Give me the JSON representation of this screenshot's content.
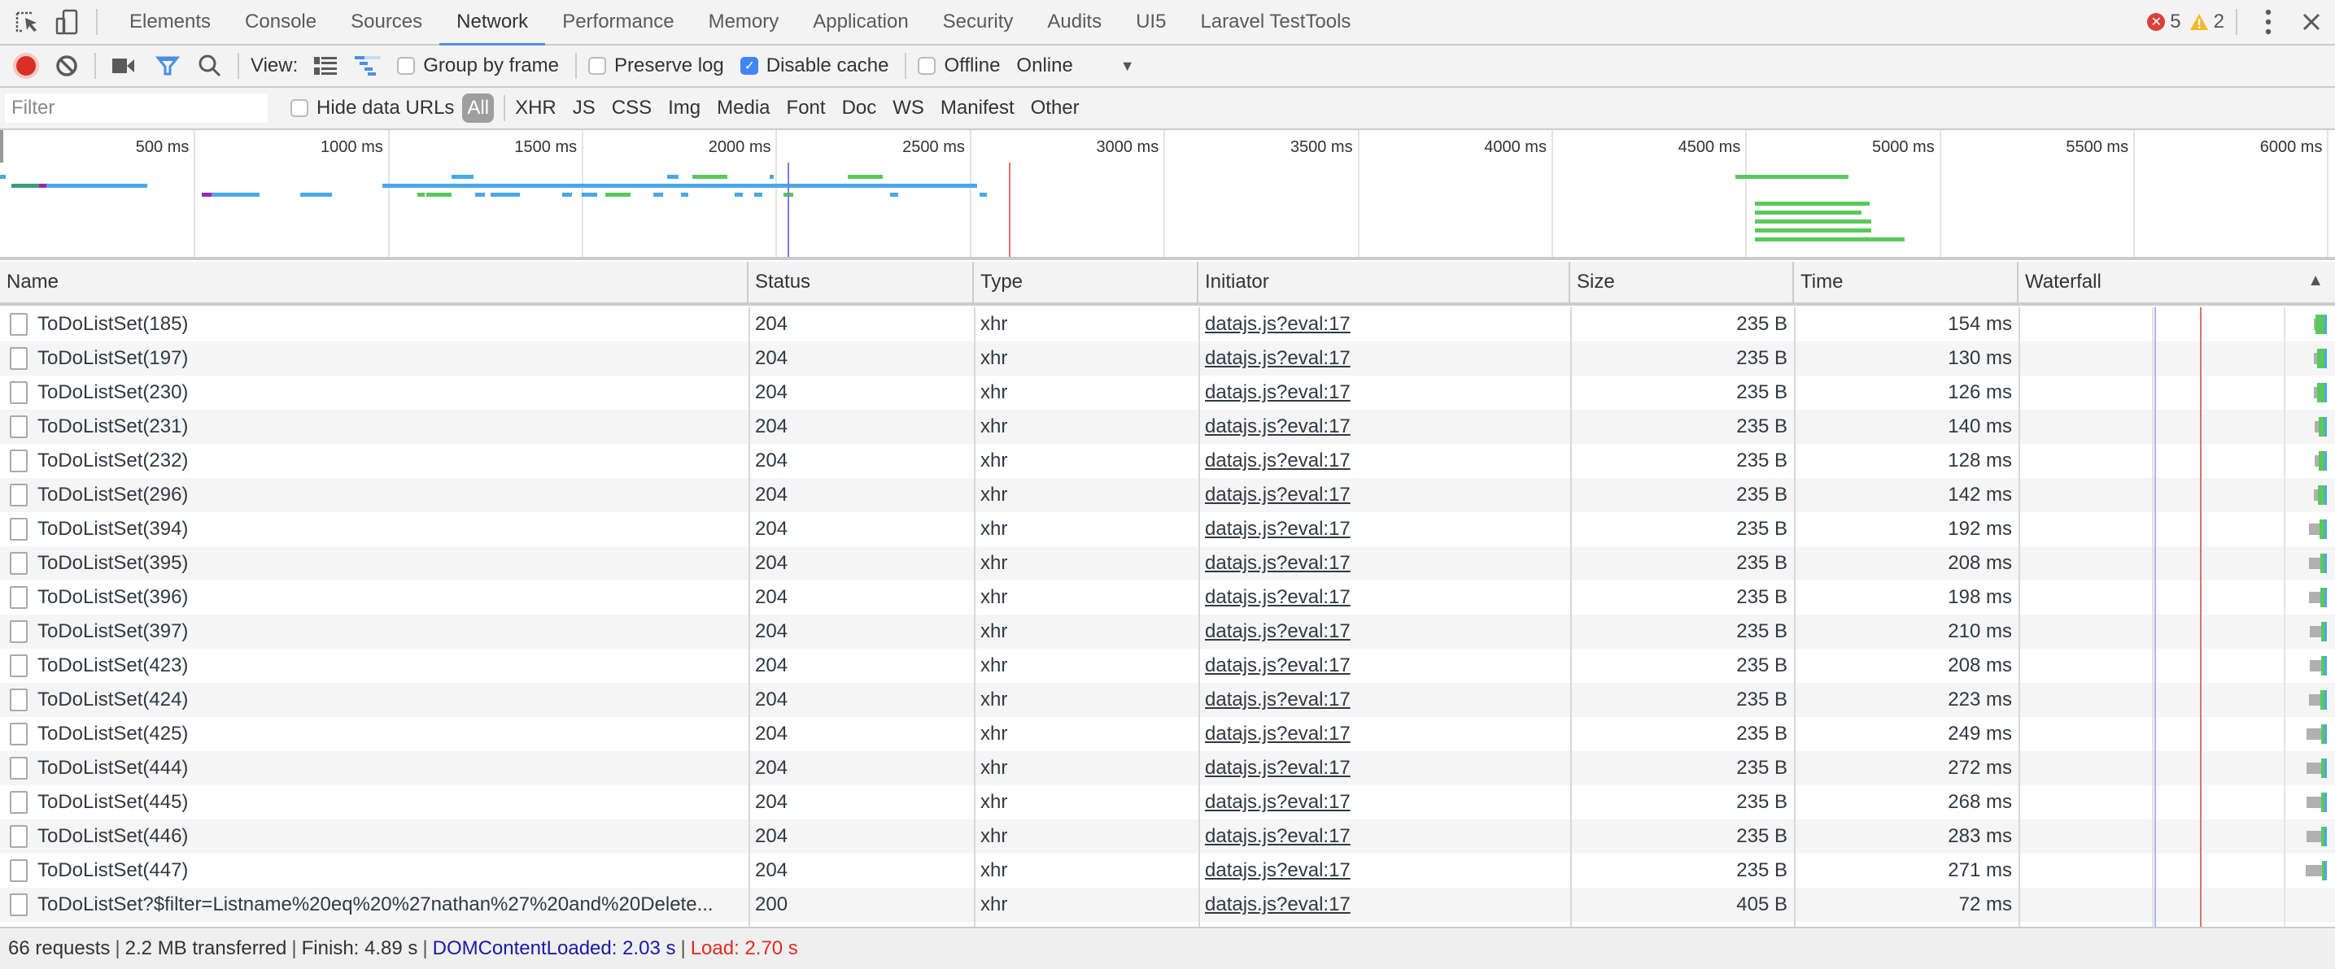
{
  "tabbar": {
    "tabs": [
      {
        "label": "Elements",
        "active": false
      },
      {
        "label": "Console",
        "active": false
      },
      {
        "label": "Sources",
        "active": false
      },
      {
        "label": "Network",
        "active": true
      },
      {
        "label": "Performance",
        "active": false
      },
      {
        "label": "Memory",
        "active": false
      },
      {
        "label": "Application",
        "active": false
      },
      {
        "label": "Security",
        "active": false
      },
      {
        "label": "Audits",
        "active": false
      },
      {
        "label": "UI5",
        "active": false
      },
      {
        "label": "Laravel TestTools",
        "active": false
      }
    ],
    "error_count": "5",
    "warning_count": "2",
    "icons": {
      "inspect": "inspect-element-icon",
      "device": "device-toolbar-icon",
      "errors": "error-icon",
      "warnings": "warning-icon",
      "menu": "more-vert-icon",
      "close": "close-icon"
    }
  },
  "toolbar": {
    "view_label": "View:",
    "group_by_frame": {
      "label": "Group by frame",
      "checked": false
    },
    "preserve_log": {
      "label": "Preserve log",
      "checked": false
    },
    "disable_cache": {
      "label": "Disable cache",
      "checked": true
    },
    "offline": {
      "label": "Offline",
      "checked": false
    },
    "throttling": {
      "value": "Online"
    },
    "colors": {
      "record": "#d93025",
      "accent": "#4a90e2"
    }
  },
  "filterbar": {
    "filter_placeholder": "Filter",
    "filter_value": "",
    "hide_data_urls": {
      "label": "Hide data URLs",
      "checked": false
    },
    "types": [
      "All",
      "XHR",
      "JS",
      "CSS",
      "Img",
      "Media",
      "Font",
      "Doc",
      "WS",
      "Manifest",
      "Other"
    ],
    "active_type": "All"
  },
  "overview": {
    "ticks": [
      "500 ms",
      "1000 ms",
      "1500 ms",
      "2000 ms",
      "2500 ms",
      "3000 ms",
      "3500 ms",
      "4000 ms",
      "4500 ms",
      "5000 ms",
      "5500 ms",
      "6000 ms"
    ],
    "tick_values_ms": [
      500,
      1000,
      1500,
      2000,
      2500,
      3000,
      3500,
      4000,
      4500,
      5000,
      5500,
      6000
    ],
    "range_ms": [
      0,
      6020
    ],
    "dom_content_loaded_ms": 2030,
    "load_ms": 2600,
    "bars": [
      {
        "lane": 0,
        "start": 0,
        "end": 15,
        "color": "#4aa7e8"
      },
      {
        "lane": 1,
        "start": 30,
        "end": 100,
        "color": "#3e9b7f"
      },
      {
        "lane": 1,
        "start": 100,
        "end": 120,
        "color": "#9c27b0"
      },
      {
        "lane": 1,
        "start": 120,
        "end": 380,
        "color": "#4aa7e8"
      },
      {
        "lane": 2,
        "start": 520,
        "end": 545,
        "color": "#9c27b0"
      },
      {
        "lane": 2,
        "start": 545,
        "end": 670,
        "color": "#4aa7e8"
      },
      {
        "lane": 2,
        "start": 775,
        "end": 855,
        "color": "#4aa7e8"
      },
      {
        "lane": 1,
        "start": 985,
        "end": 2520,
        "color": "#4aa7e8"
      },
      {
        "lane": 0,
        "start": 1165,
        "end": 1220,
        "color": "#4aa7e8"
      },
      {
        "lane": 2,
        "start": 1075,
        "end": 1095,
        "color": "#5ac85a"
      },
      {
        "lane": 2,
        "start": 1100,
        "end": 1165,
        "color": "#5ac85a"
      },
      {
        "lane": 2,
        "start": 1225,
        "end": 1250,
        "color": "#4aa7e8"
      },
      {
        "lane": 2,
        "start": 1265,
        "end": 1340,
        "color": "#4aa7e8"
      },
      {
        "lane": 2,
        "start": 1450,
        "end": 1475,
        "color": "#4aa7e8"
      },
      {
        "lane": 2,
        "start": 1500,
        "end": 1540,
        "color": "#4aa7e8"
      },
      {
        "lane": 2,
        "start": 1560,
        "end": 1625,
        "color": "#5ac85a"
      },
      {
        "lane": 2,
        "start": 1685,
        "end": 1710,
        "color": "#4aa7e8"
      },
      {
        "lane": 2,
        "start": 1755,
        "end": 1775,
        "color": "#4aa7e8"
      },
      {
        "lane": 0,
        "start": 1720,
        "end": 1750,
        "color": "#4aa7e8"
      },
      {
        "lane": 0,
        "start": 1785,
        "end": 1875,
        "color": "#5ac85a"
      },
      {
        "lane": 0,
        "start": 1985,
        "end": 1995,
        "color": "#4aa7e8"
      },
      {
        "lane": 2,
        "start": 1895,
        "end": 1915,
        "color": "#4aa7e8"
      },
      {
        "lane": 2,
        "start": 1945,
        "end": 1965,
        "color": "#4aa7e8"
      },
      {
        "lane": 2,
        "start": 2020,
        "end": 2045,
        "color": "#5ac85a"
      },
      {
        "lane": 0,
        "start": 2185,
        "end": 2275,
        "color": "#5ac85a"
      },
      {
        "lane": 2,
        "start": 2295,
        "end": 2315,
        "color": "#4aa7e8"
      },
      {
        "lane": 2,
        "start": 2525,
        "end": 2545,
        "color": "#4aa7e8"
      },
      {
        "lane": 0,
        "start": 4475,
        "end": 4765,
        "color": "#5ac85a"
      },
      {
        "lane": 3,
        "start": 4525,
        "end": 4820,
        "color": "#5ac85a"
      },
      {
        "lane": 4,
        "start": 4525,
        "end": 4800,
        "color": "#5ac85a"
      },
      {
        "lane": 5,
        "start": 4525,
        "end": 4825,
        "color": "#5ac85a"
      },
      {
        "lane": 6,
        "start": 4525,
        "end": 4825,
        "color": "#5ac85a"
      },
      {
        "lane": 7,
        "start": 4525,
        "end": 4910,
        "color": "#5ac85a"
      }
    ]
  },
  "table": {
    "columns": [
      "Name",
      "Status",
      "Type",
      "Initiator",
      "Size",
      "Time",
      "Waterfall"
    ],
    "sort_indicator": "sort-ascending-icon",
    "rows": [
      {
        "name": "ToDoListSet(185)",
        "status": "204",
        "type": "xhr",
        "initiator": "datajs.js?eval:17",
        "size": "235 B",
        "time": "154 ms",
        "wf_wait": 0.1,
        "wf_recv": 1.0
      },
      {
        "name": "ToDoListSet(197)",
        "status": "204",
        "type": "xhr",
        "initiator": "datajs.js?eval:17",
        "size": "235 B",
        "time": "130 ms",
        "wf_wait": 0.2,
        "wf_recv": 0.8
      },
      {
        "name": "ToDoListSet(230)",
        "status": "204",
        "type": "xhr",
        "initiator": "datajs.js?eval:17",
        "size": "235 B",
        "time": "126 ms",
        "wf_wait": 0.2,
        "wf_recv": 0.8
      },
      {
        "name": "ToDoListSet(231)",
        "status": "204",
        "type": "xhr",
        "initiator": "datajs.js?eval:17",
        "size": "235 B",
        "time": "140 ms",
        "wf_wait": 0.3,
        "wf_recv": 0.6
      },
      {
        "name": "ToDoListSet(232)",
        "status": "204",
        "type": "xhr",
        "initiator": "datajs.js?eval:17",
        "size": "235 B",
        "time": "128 ms",
        "wf_wait": 0.3,
        "wf_recv": 0.6
      },
      {
        "name": "ToDoListSet(296)",
        "status": "204",
        "type": "xhr",
        "initiator": "datajs.js?eval:17",
        "size": "235 B",
        "time": "142 ms",
        "wf_wait": 0.3,
        "wf_recv": 0.7
      },
      {
        "name": "ToDoListSet(394)",
        "status": "204",
        "type": "xhr",
        "initiator": "datajs.js?eval:17",
        "size": "235 B",
        "time": "192 ms",
        "wf_wait": 0.7,
        "wf_recv": 0.5
      },
      {
        "name": "ToDoListSet(395)",
        "status": "204",
        "type": "xhr",
        "initiator": "datajs.js?eval:17",
        "size": "235 B",
        "time": "208 ms",
        "wf_wait": 0.8,
        "wf_recv": 0.4
      },
      {
        "name": "ToDoListSet(396)",
        "status": "204",
        "type": "xhr",
        "initiator": "datajs.js?eval:17",
        "size": "235 B",
        "time": "198 ms",
        "wf_wait": 0.8,
        "wf_recv": 0.4
      },
      {
        "name": "ToDoListSet(397)",
        "status": "204",
        "type": "xhr",
        "initiator": "datajs.js?eval:17",
        "size": "235 B",
        "time": "210 ms",
        "wf_wait": 0.8,
        "wf_recv": 0.3
      },
      {
        "name": "ToDoListSet(423)",
        "status": "204",
        "type": "xhr",
        "initiator": "datajs.js?eval:17",
        "size": "235 B",
        "time": "208 ms",
        "wf_wait": 0.8,
        "wf_recv": 0.3
      },
      {
        "name": "ToDoListSet(424)",
        "status": "204",
        "type": "xhr",
        "initiator": "datajs.js?eval:17",
        "size": "235 B",
        "time": "223 ms",
        "wf_wait": 0.8,
        "wf_recv": 0.4
      },
      {
        "name": "ToDoListSet(425)",
        "status": "204",
        "type": "xhr",
        "initiator": "datajs.js?eval:17",
        "size": "235 B",
        "time": "249 ms",
        "wf_wait": 1.0,
        "wf_recv": 0.3
      },
      {
        "name": "ToDoListSet(444)",
        "status": "204",
        "type": "xhr",
        "initiator": "datajs.js?eval:17",
        "size": "235 B",
        "time": "272 ms",
        "wf_wait": 1.0,
        "wf_recv": 0.3
      },
      {
        "name": "ToDoListSet(445)",
        "status": "204",
        "type": "xhr",
        "initiator": "datajs.js?eval:17",
        "size": "235 B",
        "time": "268 ms",
        "wf_wait": 1.0,
        "wf_recv": 0.3
      },
      {
        "name": "ToDoListSet(446)",
        "status": "204",
        "type": "xhr",
        "initiator": "datajs.js?eval:17",
        "size": "235 B",
        "time": "283 ms",
        "wf_wait": 1.0,
        "wf_recv": 0.3
      },
      {
        "name": "ToDoListSet(447)",
        "status": "204",
        "type": "xhr",
        "initiator": "datajs.js?eval:17",
        "size": "235 B",
        "time": "271 ms",
        "wf_wait": 1.1,
        "wf_recv": 0.2
      },
      {
        "name": "ToDoListSet?$filter=Listname%20eq%20%27nathan%27%20and%20Delete...",
        "status": "200",
        "type": "xhr",
        "initiator": "datajs.js?eval:17",
        "size": "405 B",
        "time": "72 ms",
        "wf_wait": 0,
        "wf_recv": 0
      }
    ]
  },
  "statusbar": {
    "requests": "66 requests",
    "transferred": "2.2 MB transferred",
    "finish": "Finish: 4.89 s",
    "dom_content_loaded": "DOMContentLoaded: 2.03 s",
    "load": "Load: 2.70 s",
    "separator": "|",
    "colors": {
      "dcl": "#1a1aa6",
      "load": "#e42b1f"
    }
  }
}
